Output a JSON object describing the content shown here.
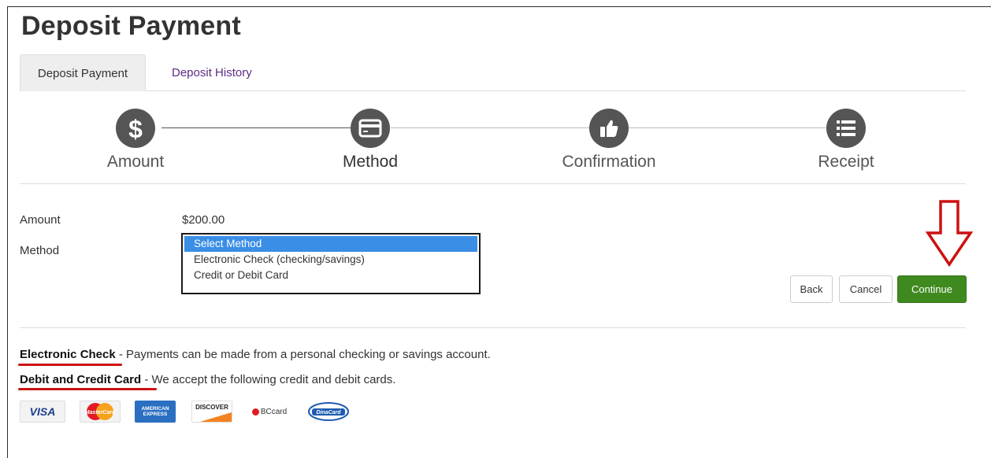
{
  "page": {
    "title": "Deposit Payment"
  },
  "tabs": [
    {
      "label": "Deposit Payment",
      "active": true
    },
    {
      "label": "Deposit History",
      "active": false
    }
  ],
  "steps": [
    {
      "label": "Amount",
      "icon": "dollar-icon",
      "active": false
    },
    {
      "label": "Method",
      "icon": "credit-card-icon",
      "active": true
    },
    {
      "label": "Confirmation",
      "icon": "thumbs-up-icon",
      "active": false
    },
    {
      "label": "Receipt",
      "icon": "list-icon",
      "active": false
    }
  ],
  "form": {
    "amount_label": "Amount",
    "amount_value": "$200.00",
    "method_label": "Method",
    "method_options": [
      "Select Method",
      "Electronic Check (checking/savings)",
      "Credit or Debit Card"
    ],
    "method_selected": "Select Method"
  },
  "buttons": {
    "back": "Back",
    "cancel": "Cancel",
    "continue": "Continue"
  },
  "info": {
    "echeck_title": "Electronic Check",
    "echeck_text": " - Payments can be made from a personal checking or savings  account.",
    "card_title": "Debit and Credit Card",
    "card_text": " - We accept the following credit and debit cards."
  },
  "cards": [
    {
      "name": "VISA",
      "icon": "visa-icon"
    },
    {
      "name": "MasterCard",
      "icon": "mastercard-icon"
    },
    {
      "name": "AMERICAN EXPRESS",
      "icon": "amex-icon"
    },
    {
      "name": "DISCOVER",
      "icon": "discover-icon"
    },
    {
      "name": "BCcard",
      "icon": "bccard-icon"
    },
    {
      "name": "DinaCard",
      "icon": "dinacard-icon"
    }
  ],
  "colors": {
    "primary_button": "#3f8a1f",
    "selection": "#3a8ee6",
    "tab_link": "#5b2a86",
    "annotation": "#cc1111",
    "step_icon": "#555555"
  }
}
